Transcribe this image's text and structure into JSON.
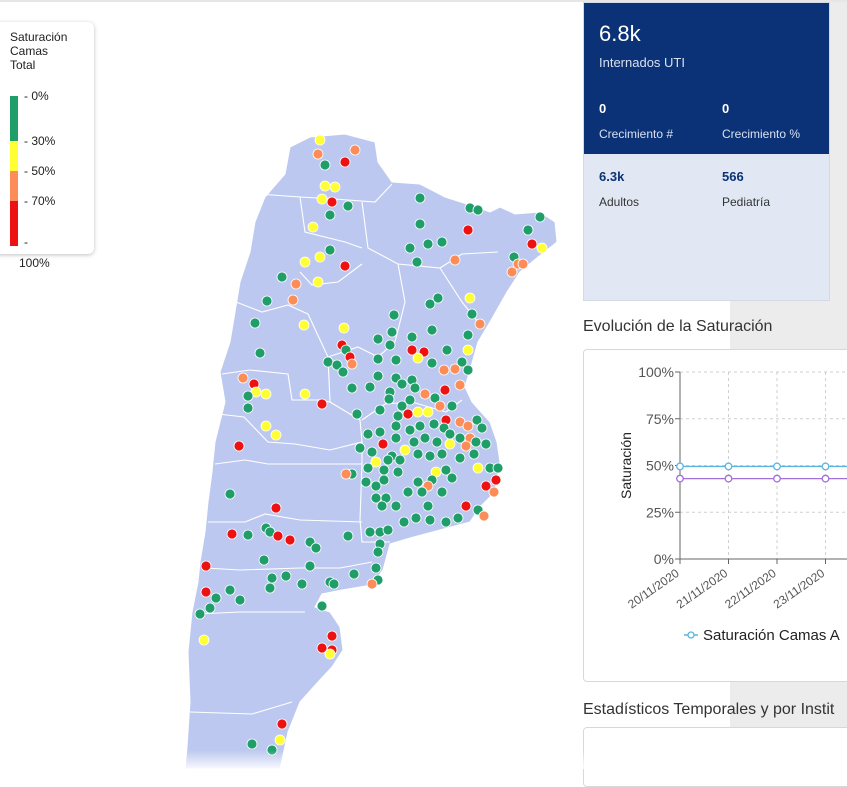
{
  "legend": {
    "title_lines": [
      "Saturación",
      "Camas",
      "Total"
    ],
    "labels": [
      "- 0%",
      "- 30%",
      "- 50%",
      "- 70%",
      "-",
      "100%"
    ],
    "colors": [
      "#1f9e6a",
      "#ffff33",
      "#fc8d59",
      "#ee1111"
    ]
  },
  "stats": {
    "total_value": "6.8k",
    "total_label": "Internados UTI",
    "growth_abs_value": "0",
    "growth_abs_label": "Crecimiento #",
    "growth_pct_value": "0",
    "growth_pct_label": "Crecimiento %",
    "adults_value": "6.3k",
    "adults_label": "Adultos",
    "pediatric_value": "566",
    "pediatric_label": "Pediatría"
  },
  "sections": {
    "evolution_title": "Evolución de la Saturación",
    "temporal_title": "Estadísticos Temporales y por Instit"
  },
  "chart_data": {
    "type": "line",
    "ylabel": "Saturación",
    "yticks": [
      "100%",
      "75%",
      "50%",
      "25%",
      "0%"
    ],
    "ylim": [
      0,
      100
    ],
    "grid": true,
    "categories": [
      "20/11/2020",
      "21/11/2020",
      "22/11/2020",
      "23/11/2020"
    ],
    "series": [
      {
        "name": "Saturación Camas A",
        "color": "#5bb5e0",
        "values": [
          49.5,
          49.5,
          49.5,
          49.5
        ]
      },
      {
        "color": "#a070d8",
        "values": [
          43,
          43,
          43,
          43
        ]
      }
    ],
    "legend_text": "Saturación Camas A"
  },
  "map": {
    "land_color": "#bcc8ef",
    "border_color": "#ffffff",
    "marker_colors": {
      "green": "#1f9e6a",
      "yellow": "#ffff33",
      "orange": "#fc8d59",
      "red": "#ee1111"
    }
  }
}
